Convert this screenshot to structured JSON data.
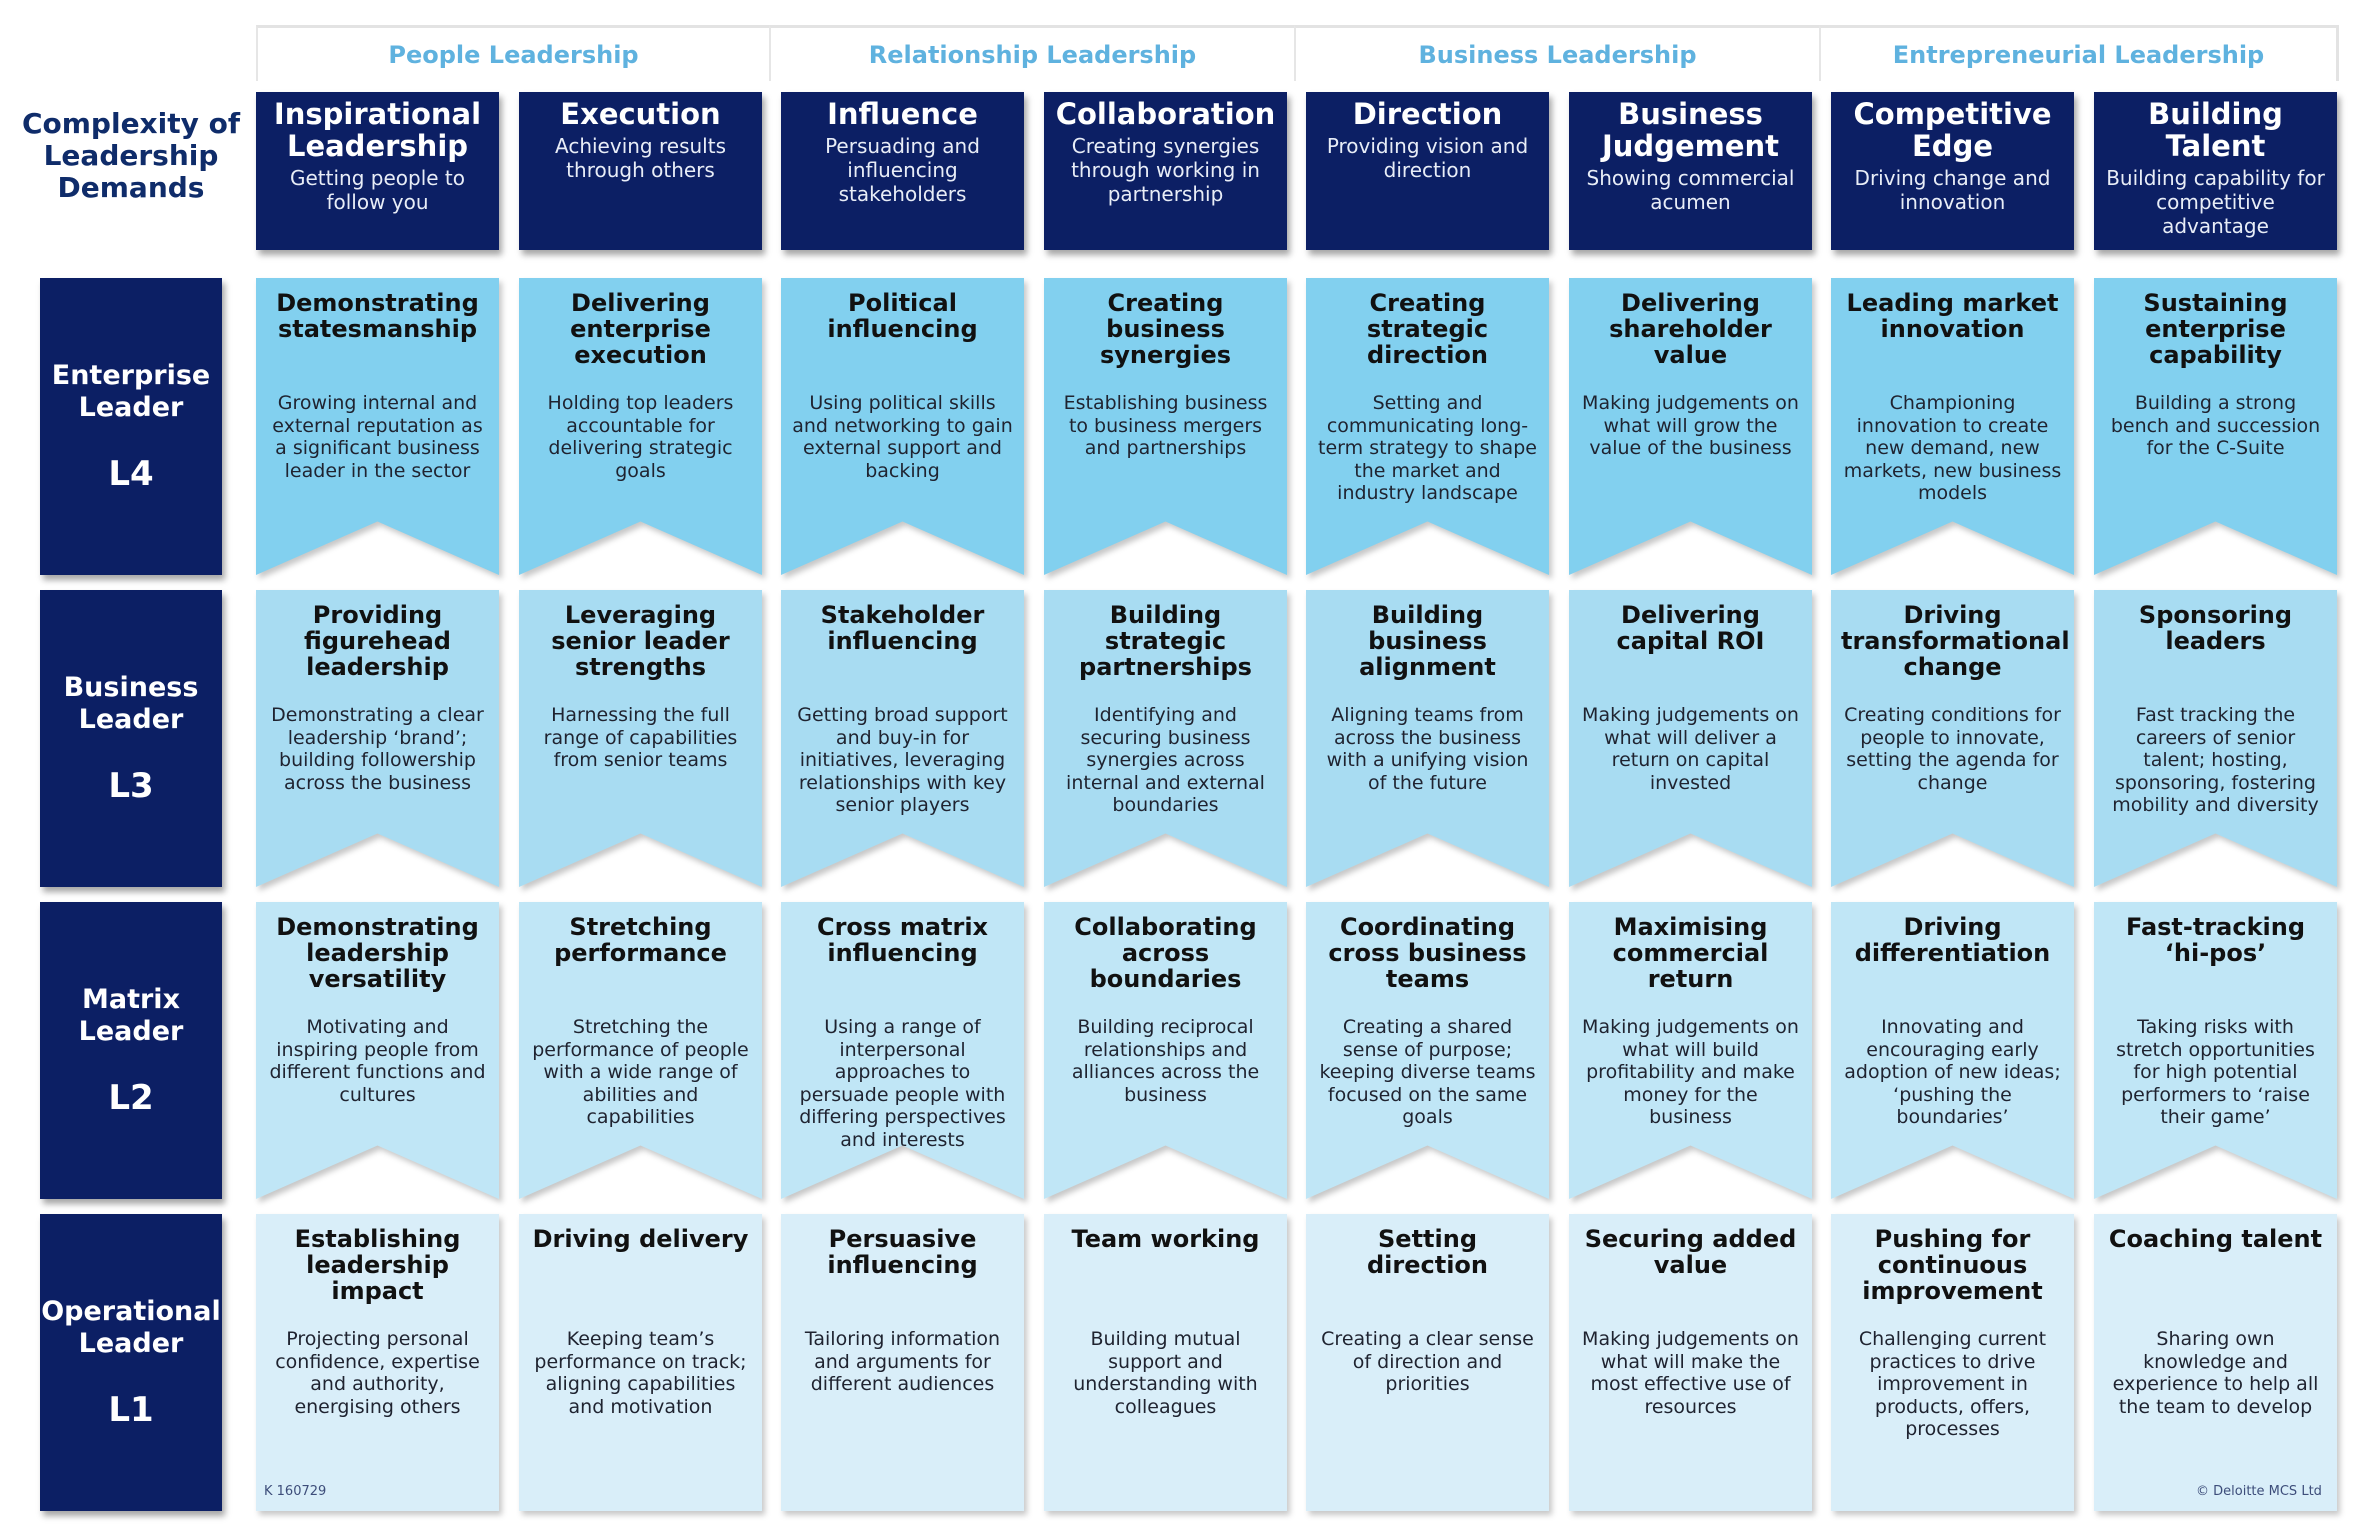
{
  "title": "Complexity of Leadership Demands",
  "groups": [
    {
      "label": "People Leadership"
    },
    {
      "label": "Relationship Leadership"
    },
    {
      "label": "Business Leadership"
    },
    {
      "label": "Entrepreneurial Leadership"
    }
  ],
  "columns": [
    {
      "title": "Inspirational Leadership",
      "subtitle": "Getting people to follow you"
    },
    {
      "title": "Execution",
      "subtitle": "Achieving results through others"
    },
    {
      "title": "Influence",
      "subtitle": "Persuading and influencing stakeholders"
    },
    {
      "title": "Collaboration",
      "subtitle": "Creating synergies through working in partnership"
    },
    {
      "title": "Direction",
      "subtitle": "Providing vision and direction"
    },
    {
      "title": "Business Judgement",
      "subtitle": "Showing commercial acumen"
    },
    {
      "title": "Competitive Edge",
      "subtitle": "Driving change and innovation"
    },
    {
      "title": "Building Talent",
      "subtitle": "Building capability for competitive advantage"
    }
  ],
  "rows": [
    {
      "name": "Enterprise Leader",
      "level": "L4",
      "cells": [
        {
          "title": "Demonstrating statesmanship",
          "desc": "Growing internal and external reputation as a significant business leader in the sector"
        },
        {
          "title": "Delivering enterprise execution",
          "desc": "Holding top leaders accountable for delivering strategic goals"
        },
        {
          "title": "Political influencing",
          "desc": "Using political skills and networking to gain external support and backing"
        },
        {
          "title": "Creating business synergies",
          "desc": "Establishing business to business mergers and partnerships"
        },
        {
          "title": "Creating strategic direction",
          "desc": "Setting and communicating long-term strategy to shape the market and industry landscape"
        },
        {
          "title": "Delivering shareholder value",
          "desc": "Making judgements on what will grow the value of the business"
        },
        {
          "title": "Leading market innovation",
          "desc": "Championing innovation to create new demand, new markets, new business models"
        },
        {
          "title": "Sustaining enterprise capability",
          "desc": "Building a strong bench and succession for the C-Suite"
        }
      ]
    },
    {
      "name": "Business Leader",
      "level": "L3",
      "cells": [
        {
          "title": "Providing figurehead leadership",
          "desc": "Demonstrating a clear leadership ‘brand’; building followership across the business"
        },
        {
          "title": "Leveraging senior leader strengths",
          "desc": "Harnessing the full range of capabilities from senior teams"
        },
        {
          "title": "Stakeholder influencing",
          "desc": "Getting broad support and buy-in for initiatives, leveraging relationships with key senior players"
        },
        {
          "title": "Building strategic partnerships",
          "desc": "Identifying and securing business synergies across internal and external boundaries"
        },
        {
          "title": "Building business alignment",
          "desc": "Aligning teams from across the business with a unifying vision of the future"
        },
        {
          "title": "Delivering capital ROI",
          "desc": "Making judgements on what will deliver a return on capital invested"
        },
        {
          "title": "Driving transformational change",
          "desc": "Creating conditions for people to innovate, setting the agenda for change"
        },
        {
          "title": "Sponsoring leaders",
          "desc": "Fast tracking the careers of senior talent; hosting, sponsoring, fostering mobility and diversity"
        }
      ]
    },
    {
      "name": "Matrix Leader",
      "level": "L2",
      "cells": [
        {
          "title": "Demonstrating leadership versatility",
          "desc": "Motivating and inspiring people from different functions and cultures"
        },
        {
          "title": "Stretching performance",
          "desc": "Stretching the performance of people with a wide range of abilities and capabilities"
        },
        {
          "title": "Cross matrix influencing",
          "desc": "Using a range of interpersonal approaches to persuade people with differing perspectives and interests"
        },
        {
          "title": "Collaborating across boundaries",
          "desc": "Building reciprocal relationships and alliances across the business"
        },
        {
          "title": "Coordinating cross business teams",
          "desc": "Creating a shared sense of purpose; keeping diverse teams focused on the same goals"
        },
        {
          "title": "Maximising commercial return",
          "desc": "Making judgements on what will build profitability and make money for the business"
        },
        {
          "title": "Driving differentiation",
          "desc": "Innovating and encouraging early adoption of new ideas; ‘pushing the boundaries’"
        },
        {
          "title": "Fast-tracking ‘hi-pos’",
          "desc": "Taking risks with stretch opportunities for high potential performers to ‘raise their game’"
        }
      ]
    },
    {
      "name": "Operational Leader",
      "level": "L1",
      "cells": [
        {
          "title": "Establishing leadership impact",
          "desc": "Projecting personal confidence, expertise and authority, energising others"
        },
        {
          "title": "Driving delivery",
          "desc": "Keeping team’s performance on track; aligning capabilities and motivation"
        },
        {
          "title": "Persuasive influencing",
          "desc": "Tailoring information and arguments for different audiences"
        },
        {
          "title": "Team working",
          "desc": "Building mutual support and understanding with colleagues"
        },
        {
          "title": "Setting direction",
          "desc": "Creating a clear sense of direction and priorities"
        },
        {
          "title": "Securing added value",
          "desc": "Making judgements on what will make the most effective use of resources"
        },
        {
          "title": "Pushing for continuous improvement",
          "desc": "Challenging current practices to drive improvement in products, offers, processes"
        },
        {
          "title": "Coaching talent",
          "desc": "Sharing own knowledge and experience to help all the team to develop"
        }
      ]
    }
  ],
  "footer": {
    "reference": "K 160729",
    "copyright": "© Deloitte MCS Ltd"
  },
  "colors": {
    "navy": "#0c1f64",
    "group_label": "#5fb2df",
    "row_l4": "#82d0ef",
    "row_l3": "#a8dcf2",
    "row_l2": "#c0e6f6",
    "row_l1": "#d9eef9"
  }
}
